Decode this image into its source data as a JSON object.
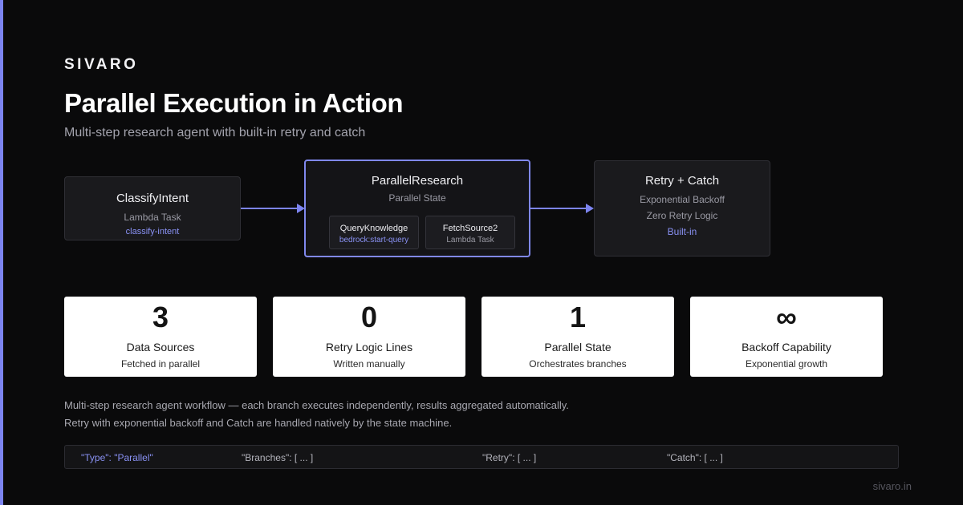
{
  "brand": "SIVARO",
  "title": "Parallel Execution in Action",
  "subtitle": "Multi-step research agent with built-in retry and catch",
  "colors": {
    "accent": "#7c84f0",
    "background": "#0a0a0b",
    "card": "#ffffff"
  },
  "diagram": {
    "nodes": {
      "classify": {
        "title": "ClassifyIntent",
        "sub": "Lambda Task",
        "link": "classify-intent"
      },
      "parallel": {
        "title": "ParallelResearch",
        "sub": "Parallel State",
        "branches": [
          {
            "title": "QueryKnowledge",
            "sub": "bedrock:start-query"
          },
          {
            "title": "FetchSource2",
            "sub": "Lambda Task"
          }
        ]
      },
      "retry": {
        "title": "Retry + Catch",
        "line1": "Exponential Backoff",
        "line2": "Zero Retry Logic",
        "link": "Built-in"
      }
    },
    "edges": [
      {
        "from": "ClassifyIntent",
        "to": "ParallelResearch"
      },
      {
        "from": "ParallelResearch",
        "to": "Retry + Catch"
      }
    ]
  },
  "stats": [
    {
      "value": "3",
      "label": "Data Sources",
      "sub": "Fetched in parallel"
    },
    {
      "value": "0",
      "label": "Retry Logic Lines",
      "sub": "Written manually"
    },
    {
      "value": "1",
      "label": "Parallel State",
      "sub": "Orchestrates branches"
    },
    {
      "value": "∞",
      "label": "Backoff Capability",
      "sub": "Exponential growth"
    }
  ],
  "description": {
    "line1": "Multi-step research agent workflow — each branch executes independently, results aggregated automatically.",
    "line2": "Retry with exponential backoff and Catch are handled natively by the state machine."
  },
  "code": {
    "type": "\"Type\": \"Parallel\"",
    "branches": "\"Branches\": [ ... ]",
    "retry": "\"Retry\": [ ... ]",
    "catch": "\"Catch\": [ ... ]"
  },
  "footer": "sivaro.in"
}
